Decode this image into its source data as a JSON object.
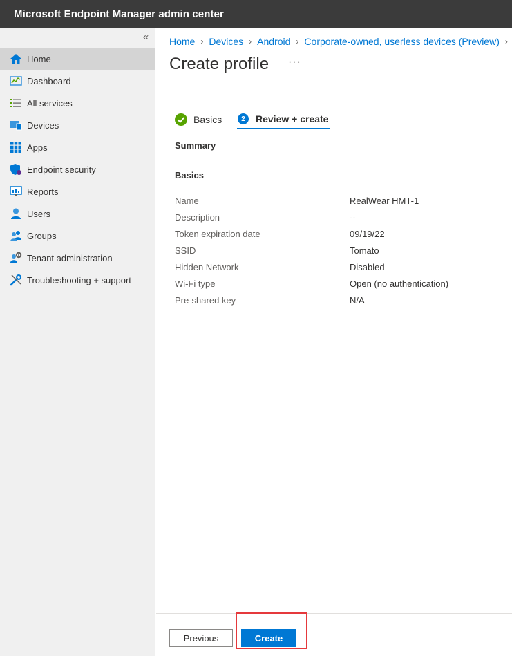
{
  "app": {
    "title": "Microsoft Endpoint Manager admin center"
  },
  "sidebar": {
    "collapse_glyph": "«",
    "items": [
      {
        "label": "Home",
        "icon": "home-icon",
        "active": true
      },
      {
        "label": "Dashboard",
        "icon": "dashboard-icon"
      },
      {
        "label": "All services",
        "icon": "list-icon"
      },
      {
        "label": "Devices",
        "icon": "devices-icon"
      },
      {
        "label": "Apps",
        "icon": "apps-grid-icon"
      },
      {
        "label": "Endpoint security",
        "icon": "shield-icon"
      },
      {
        "label": "Reports",
        "icon": "reports-icon"
      },
      {
        "label": "Users",
        "icon": "user-icon"
      },
      {
        "label": "Groups",
        "icon": "groups-icon"
      },
      {
        "label": "Tenant administration",
        "icon": "tenant-admin-icon"
      },
      {
        "label": "Troubleshooting + support",
        "icon": "wrench-icon"
      }
    ]
  },
  "breadcrumb": [
    "Home",
    "Devices",
    "Android",
    "Corporate-owned, userless devices (Preview)"
  ],
  "breadcrumb_sep": "›",
  "page": {
    "title": "Create profile",
    "more": "···"
  },
  "steps": [
    {
      "label": "Basics",
      "state": "complete"
    },
    {
      "label": "Review + create",
      "number": "2",
      "state": "current"
    }
  ],
  "summary": {
    "heading": "Summary",
    "section": "Basics",
    "rows": [
      {
        "key": "Name",
        "value": "RealWear HMT-1"
      },
      {
        "key": "Description",
        "value": "--"
      },
      {
        "key": "Token expiration date",
        "value": "09/19/22"
      },
      {
        "key": "SSID",
        "value": "Tomato"
      },
      {
        "key": "Hidden Network",
        "value": "Disabled"
      },
      {
        "key": "Wi-Fi type",
        "value": "Open (no authentication)"
      },
      {
        "key": "Pre-shared key",
        "value": "N/A"
      }
    ]
  },
  "footer": {
    "previous_label": "Previous",
    "create_label": "Create"
  },
  "colors": {
    "accent": "#0078d4",
    "topbar": "#3b3b3b",
    "success": "#57a300",
    "highlight": "#e5393c"
  }
}
